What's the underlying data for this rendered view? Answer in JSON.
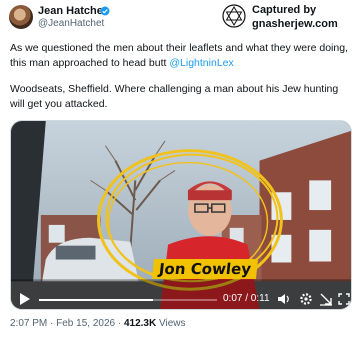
{
  "author": {
    "name": "Jean Hatchet",
    "handle": "@JeanHatchet"
  },
  "capture": {
    "line1": "Captured by",
    "line2": "gnasherjew.com"
  },
  "tweet": {
    "p1_text": "As we questioned the men about their leaflets and what they were doing, this man approached to head butt ",
    "p1_mention": "@LightninLex",
    "p2_text": "Woodseats, Sheffield. Where challenging a man about his Jew hunting will get you attacked."
  },
  "video": {
    "name_label": "Jon Cowley",
    "time": "0:07 / 0:11",
    "progress": 0.64
  },
  "meta": {
    "time": "2:07 PM · Feb 15, 2026 · ",
    "views": "412.3K",
    "views_label": " Views"
  },
  "icons": [
    "verified-icon",
    "star-of-david-icon",
    "play-icon",
    "volume-icon",
    "settings-icon",
    "fullscreen-icon",
    "expand-icon"
  ],
  "colors": {
    "accent": "#1d9bf0",
    "label_bg": "#f2c200",
    "muted": "#536471"
  }
}
